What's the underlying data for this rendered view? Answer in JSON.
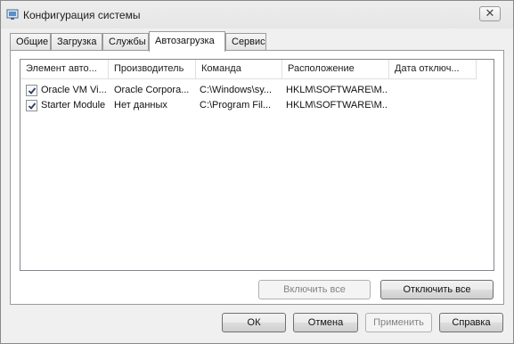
{
  "window": {
    "title": "Конфигурация системы",
    "close_glyph": "✕"
  },
  "tabs": [
    {
      "label": "Общие",
      "active": false
    },
    {
      "label": "Загрузка",
      "active": false
    },
    {
      "label": "Службы",
      "active": false
    },
    {
      "label": "Автозагрузка",
      "active": true
    },
    {
      "label": "Сервис",
      "active": false
    }
  ],
  "startup_list": {
    "columns": [
      "Элемент авто...",
      "Производитель",
      "Команда",
      "Расположение",
      "Дата отключ..."
    ],
    "rows": [
      {
        "checked": true,
        "item": "Oracle VM Vi...",
        "manufacturer": "Oracle Corpora...",
        "command": "C:\\Windows\\sy...",
        "location": "HKLM\\SOFTWARE\\M...",
        "date": ""
      },
      {
        "checked": true,
        "item": "Starter Module",
        "manufacturer": "Нет данных",
        "command": "C:\\Program Fil...",
        "location": "HKLM\\SOFTWARE\\M...",
        "date": ""
      }
    ]
  },
  "panel_buttons": {
    "enable_all": "Включить все",
    "disable_all": "Отключить все"
  },
  "dialog_buttons": {
    "ok": "ОК",
    "cancel": "Отмена",
    "apply": "Применить",
    "help": "Справка"
  }
}
